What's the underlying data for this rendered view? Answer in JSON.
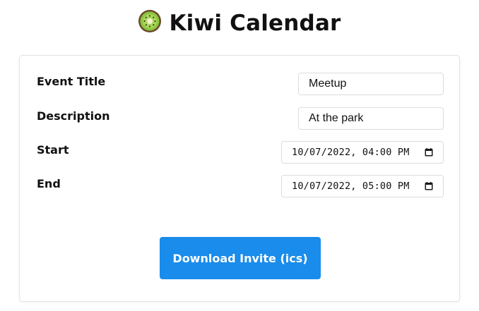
{
  "header": {
    "title": "Kiwi Calendar",
    "icon": "kiwi-fruit-icon"
  },
  "form": {
    "fields": [
      {
        "label": "Event Title",
        "value": "Meetup"
      },
      {
        "label": "Description",
        "value": "At the park"
      },
      {
        "label": "Start",
        "value": "10/07/2022, 04:00 PM",
        "icon": "calendar-icon"
      },
      {
        "label": "End",
        "value": "10/07/2022, 05:00 PM",
        "icon": "calendar-icon"
      }
    ],
    "submit_label": "Download Invite (ics)"
  },
  "colors": {
    "button": "#1a8ceb",
    "card_border": "#e3e3e3"
  }
}
